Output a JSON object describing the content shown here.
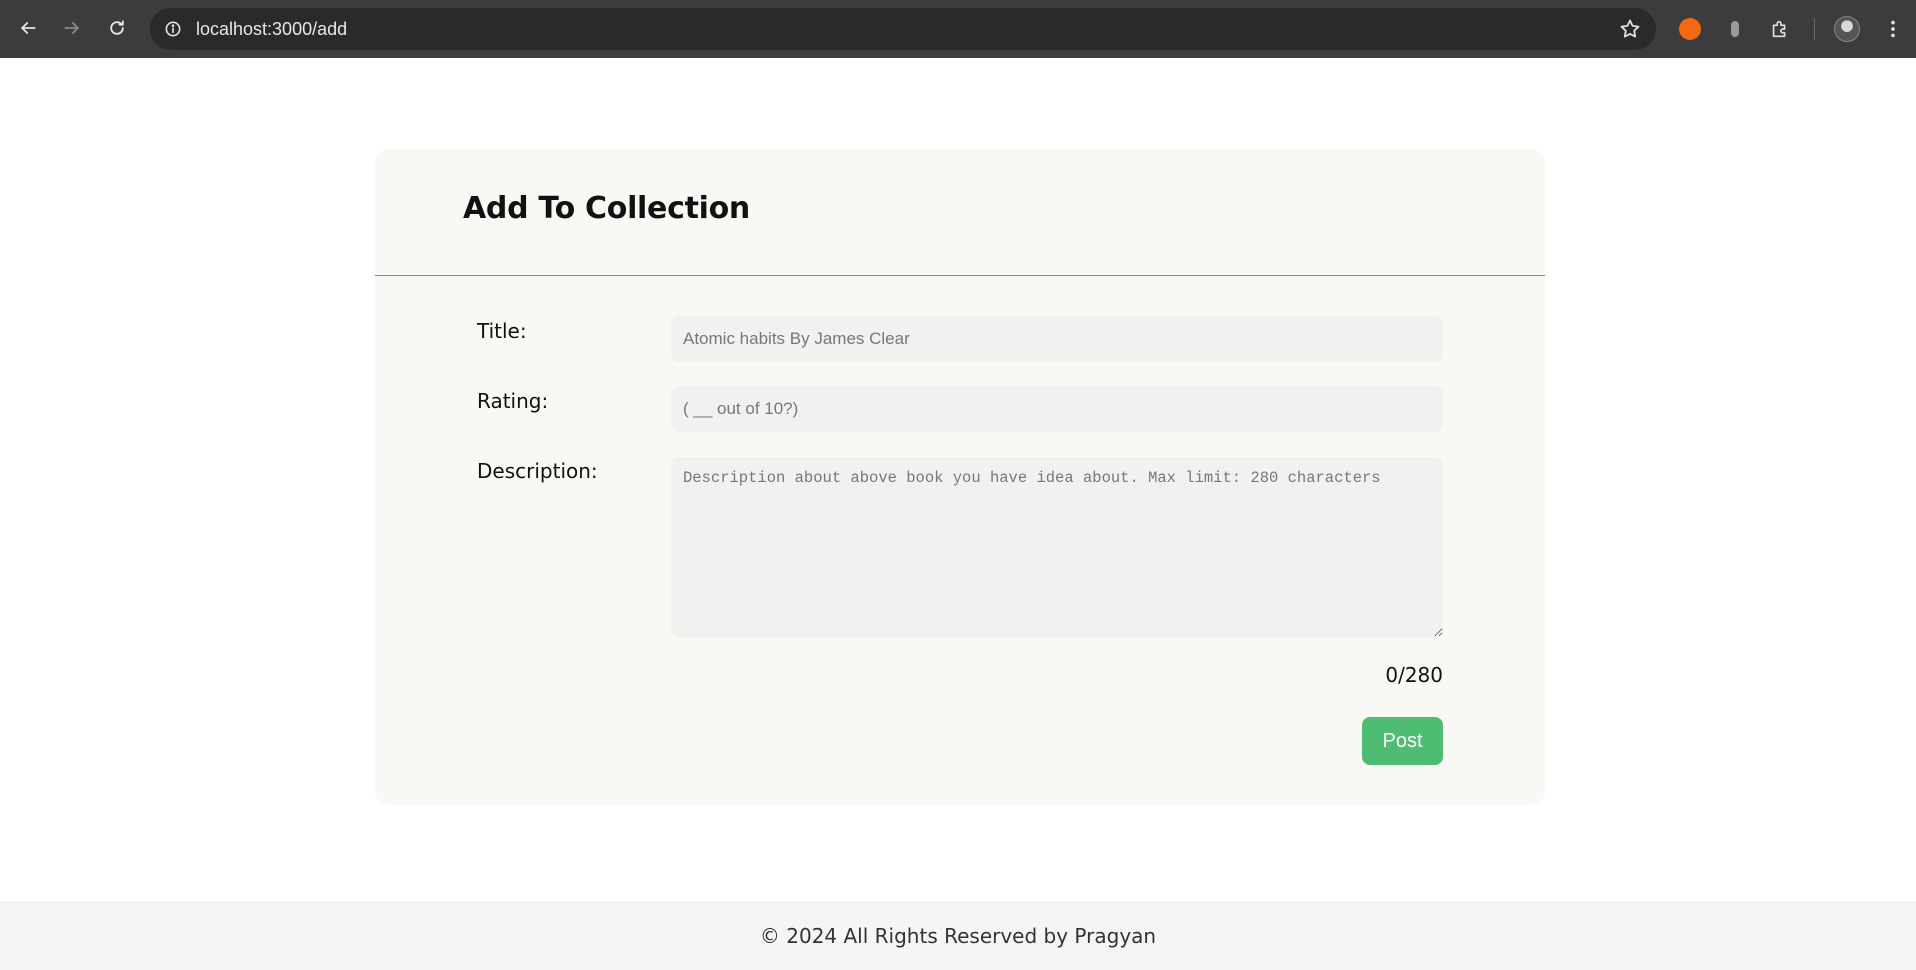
{
  "browser": {
    "url": "localhost:3000/add",
    "icons": [
      "back-arrow-icon",
      "forward-arrow-icon",
      "reload-icon",
      "site-info-icon",
      "bookmark-star-icon",
      "extension-icon",
      "extensions-puzzle-icon",
      "profile-avatar",
      "more-menu-icon"
    ]
  },
  "form": {
    "heading": "Add To Collection",
    "title_label": "Title:",
    "title_placeholder": "Atomic habits By James Clear",
    "rating_label": "Rating:",
    "rating_placeholder": "( __ out of 10?)",
    "description_label": "Description:",
    "description_placeholder": "Description about above book you have idea about. Max limit: 280 characters",
    "char_count": "0/280",
    "post_button": "Post"
  },
  "footer": {
    "text": "© 2024 All Rights Reserved by Pragyan"
  },
  "colors": {
    "chrome_bg": "#3c3c3c",
    "card_bg": "#faf8f5",
    "input_bg": "#f2f1ef",
    "post_button_bg": "#4fbc74",
    "footer_bg": "#f5f5f5"
  }
}
